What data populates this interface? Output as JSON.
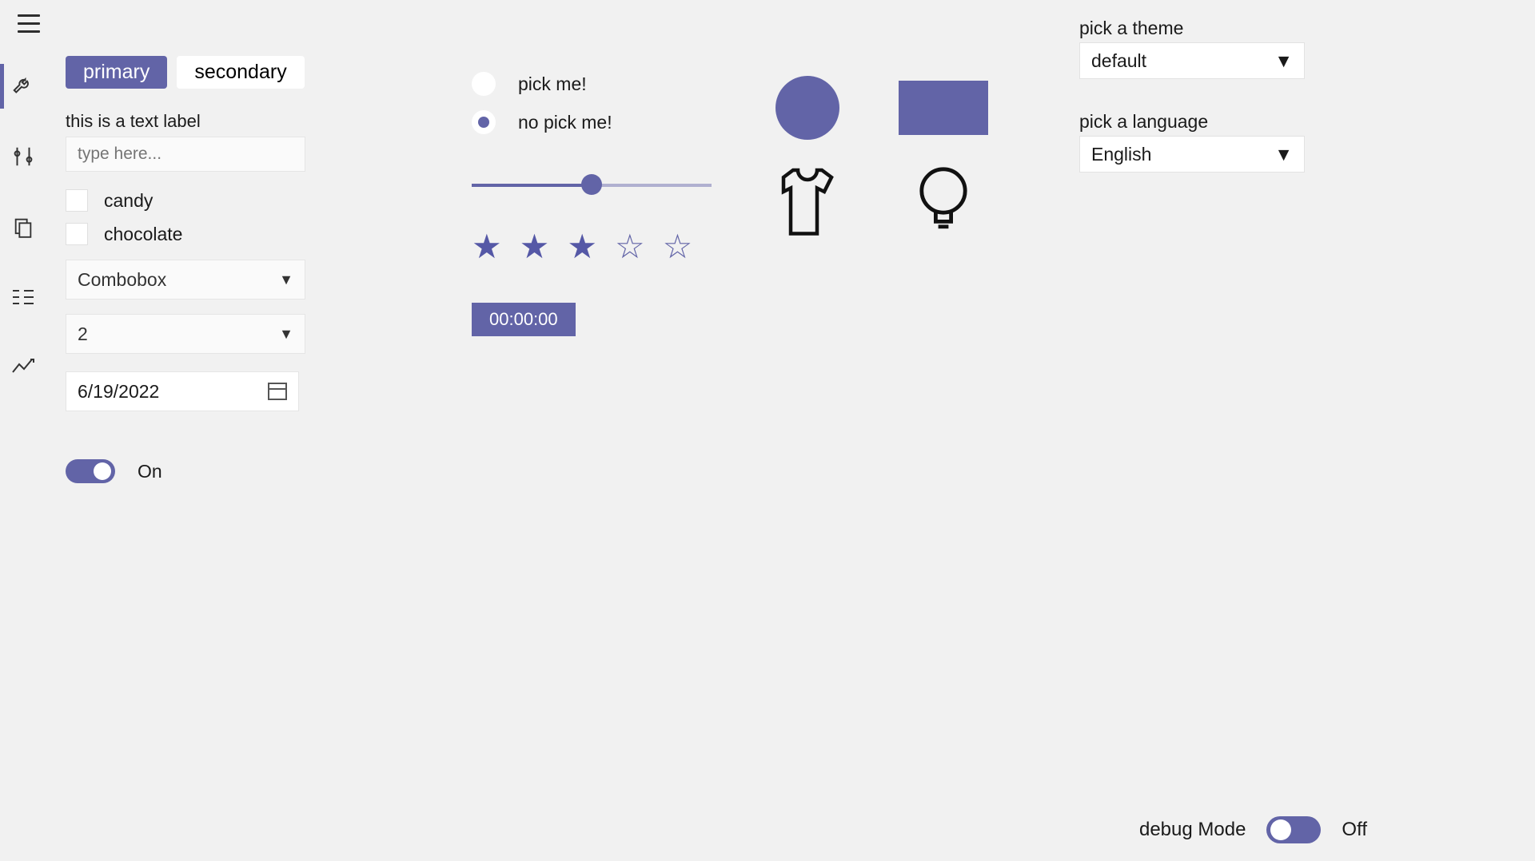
{
  "pivot": {
    "primary_label": "primary",
    "secondary_label": "secondary"
  },
  "leftPanel": {
    "text_label": "this is a text label",
    "textbox_placeholder": "type here...",
    "checkboxes": {
      "candy": "candy",
      "chocolate": "chocolate"
    },
    "combobox_label": "Combobox",
    "number_value": "2",
    "date_value": "6/19/2022",
    "toggle_on_label": "On"
  },
  "radio": {
    "option1": "pick me!",
    "option2": "no pick me!"
  },
  "slider_value": 50,
  "rating_value": 3,
  "time_value": "00:00:00",
  "right": {
    "theme_label": "pick a theme",
    "theme_value": "default",
    "language_label": "pick a language",
    "language_value": "English"
  },
  "debug": {
    "label": "debug Mode",
    "state_label": "Off"
  },
  "colors": {
    "accent": "#6264a7"
  }
}
